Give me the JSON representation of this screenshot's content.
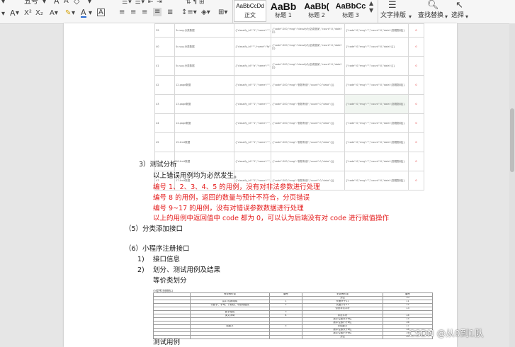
{
  "ribbon": {
    "font_size": "五号",
    "styles": [
      {
        "preview": "AaBbCcDd",
        "label": "正文"
      },
      {
        "preview": "AaBb",
        "label": "标题 1"
      },
      {
        "preview": "AaBb(",
        "label": "标题 2"
      },
      {
        "preview": "AaBbCc",
        "label": "标题 3"
      }
    ],
    "text_layout": "文字排版",
    "find_replace": "查找替换",
    "select": "选择"
  },
  "table1": {
    "rows": [
      {
        "id": "39",
        "name": "3c.sug.分类数据",
        "request": "{\"classify_id\":\"1\",\"name\":\"\",\"type\":\"1\",\"page\":1,\"limit\":10}",
        "expected": "{\"code\":200,\"msg\":\"classify为空或错误\",\"count\":0,\"data\":[]}",
        "actual": "{\"code\":0,\"msg\":\"\",\"count\":0,\"data\":[数据数组]}",
        "result": "0"
      },
      {
        "id": "40",
        "name": "4c.sug.分类数据",
        "request": "{\"classify_id\":\"\",\"name\":\"fp\",\"type\":\"1\",\"page\":1,\"limit\":10}",
        "expected": "{\"code\":200,\"msg\":\"classify为空或错误\",\"count\":0,\"data\":[]}",
        "actual": "{\"code\":0,\"msg\":\"\",\"count\":0,\"data\":[]}",
        "result": "0"
      },
      {
        "id": "41",
        "name": "5c.sug.分类数据",
        "request": "{\"classify_id\":\"a\",\"name\":\"\",\"type\":\"1\",\"page\":1,\"limit\":10}",
        "expected": "{\"code\":200,\"msg\":\"classify为空或错误\",\"count\":0,\"data\":[]}",
        "actual": "{\"code\":0,\"msg\":\"\",\"count\":0,\"data\":[]}",
        "result": "0"
      },
      {
        "id": "42",
        "name": "12.page数据",
        "request": "{\"classify_id\":\"1\",\"name\":\"\",\"type\":\"1\",\"page\":0,\"limit\":10}",
        "expected": "{\"code\":200,\"msg\":\"参数有误\",\"count\":0,\"data\":[]}",
        "actual": "{\"code\":0,\"msg\":\"\",\"count\":0,\"data\":[数据数组]}",
        "result": "0"
      },
      {
        "id": "43",
        "name": "13.page数据",
        "request": "{\"classify_id\":\"1\",\"name\":\"\",\"type\":\"1\",\"page\":-1,\"limit\":10}",
        "expected": "{\"code\":200,\"msg\":\"参数有误\",\"count\":0,\"data\":[]}",
        "actual": "{\"code\":0,\"msg\":\"\",\"count\":0,\"data\":[数据数组]}",
        "result": "0"
      },
      {
        "id": "44",
        "name": "14.page数据",
        "request": "{\"classify_id\":\"1\",\"name\":\"\",\"type\":\"1\",\"page\":\"a\",\"limit\":10}",
        "expected": "{\"code\":200,\"msg\":\"参数有误\",\"count\":0,\"data\":[]}",
        "actual": "{\"code\":0,\"msg\":\"\",\"count\":0,\"data\":[数据数组]}",
        "result": "0"
      },
      {
        "id": "45",
        "name": "15.limit数据",
        "request": "{\"classify_id\":\"1\",\"name\":\"\",\"type\":\"1\",\"page\":1,\"limit\":0}",
        "expected": "{\"code\":200,\"msg\":\"参数有误\",\"count\":0,\"data\":[]}",
        "actual": "{\"code\":0,\"msg\":\"\",\"count\":0,\"data\":[数据数组]}",
        "result": "0"
      },
      {
        "id": "46",
        "name": "16.limit数据",
        "request": "{\"classify_id\":\"1\",\"name\":\"\",\"type\":\"1\",\"page\":1,\"limit\":-1}",
        "expected": "{\"code\":200,\"msg\":\"参数有误\",\"count\":0,\"data\":[]}",
        "actual": "{\"code\":0,\"msg\":\"\",\"count\":0,\"data\":[数据数组]}",
        "result": "0"
      },
      {
        "id": "47",
        "name": "17.limit数据",
        "request": "{\"classify_id\":\"1\",\"name\":\"\",\"type\":\"1\",\"page\":1,\"limit\":\"a\"}",
        "expected": "{\"code\":200,\"msg\":\"参数有误\",\"count\":0,\"data\":[]}",
        "actual": "{\"code\":0,\"msg\":\"\",\"count\":0,\"data\":[数据数组]}",
        "result": "0"
      }
    ]
  },
  "doc": {
    "l1": "3）测试分析",
    "l2": "以上错误用例均为必然发生。",
    "l3": "编号 1、2、3、4、5 的用例，没有对非法参数进行处理",
    "l4": "编号 8 的用例，返回的数量与预计不符合，分页错误",
    "l5": "编号 9~17 的用例，没有对错误参数数据进行处理",
    "l6": "以上的用例中返回值中 code 都为 0，可以认为后端没有对 code 进行赋值操作",
    "l7": "（5）分类添加接口",
    "l8": "（6）小程序注册接口",
    "l9n": "1)",
    "l9": "接口信息",
    "l10n": "2)",
    "l10": "划分、测试用例及结果",
    "l11": "等价类划分",
    "l12": "测试用例"
  },
  "table2": {
    "caption": "小程序注册接口",
    "header": [
      "",
      "有效等价类",
      "编号",
      "无效等价类",
      "编号"
    ],
    "rows": [
      [
        "",
        "",
        "",
        "为空",
        "10"
      ],
      [
        "",
        "由11位数组成",
        "1",
        "长度大于11",
        "11"
      ],
      [
        "",
        "以数字、字母、下划线、中划线组成",
        "2",
        "长度小于11",
        "12"
      ],
      [
        "",
        "",
        "",
        "包含非法字符",
        "13"
      ],
      [
        "",
        "数字组成",
        "3",
        "",
        ""
      ],
      [
        "",
        "英文字母",
        "4",
        "非法字符",
        "14"
      ],
      [
        "",
        "",
        "",
        "数字位数大于6位",
        "15"
      ],
      [
        "",
        "",
        "",
        "数字位数小于6位",
        "16"
      ],
      [
        "",
        "纯数字",
        "5",
        "非纯数字",
        "17"
      ],
      [
        "",
        "",
        "",
        "数字位数大于6位",
        "18"
      ],
      [
        "",
        "",
        "",
        "数字位数小于6位",
        "19"
      ],
      [
        "",
        "",
        "",
        "为空",
        "20"
      ]
    ]
  },
  "watermark": "CSDN @从0到1队"
}
